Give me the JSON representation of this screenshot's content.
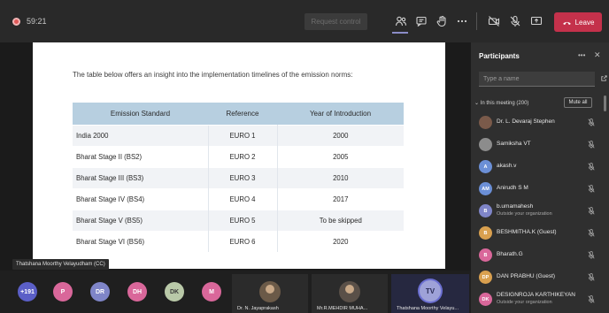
{
  "topbar": {
    "timer": "59:21",
    "request_control": "Request control",
    "leave": "Leave",
    "colors": {
      "leave": "#c4314b",
      "recording": "#e05a5a"
    }
  },
  "slide": {
    "intro": "The table below offers an insight into the implementation timelines of the emission norms:",
    "table": {
      "headers": [
        "Emission Standard",
        "Reference",
        "Year of Introduction"
      ],
      "rows": [
        [
          "India 2000",
          "EURO 1",
          "2000"
        ],
        [
          "Bharat Stage II (BS2)",
          "EURO 2",
          "2005"
        ],
        [
          "Bharat Stage III (BS3)",
          "EURO 3",
          "2010"
        ],
        [
          "Bharat Stage IV (BS4)",
          "EURO 4",
          "2017"
        ],
        [
          "Bharat Stage V (BS5)",
          "EURO 5",
          "To be skipped"
        ],
        [
          "Bharat Stage VI (BS6)",
          "EURO 6",
          "2020"
        ]
      ]
    }
  },
  "presenter_label": "Thatshana Moorthy Velayudham (CC)",
  "bottom": {
    "overflow_count": "+191",
    "avatars": [
      {
        "initials": "P",
        "color": "#d9679a"
      },
      {
        "initials": "DR",
        "color": "#7f85c8"
      },
      {
        "initials": "DH",
        "color": "#d9679a"
      },
      {
        "initials": "DK",
        "color": "#b9c9a8"
      },
      {
        "initials": "M",
        "color": "#d9679a"
      }
    ],
    "tiles": [
      {
        "name": "Dr. N. Jayaprakash"
      },
      {
        "name": "Mr.R.MEHDIR MUHA..."
      },
      {
        "name": "Thatshana Moorthy Velayu...",
        "initials": "TV"
      }
    ]
  },
  "participants": {
    "title": "Participants",
    "search_placeholder": "Type a name",
    "section": "In this meeting (200)",
    "mute_all": "Mute all",
    "list": [
      {
        "name": "Dr. L. Devaraj Stephen",
        "initials": "",
        "color": "#7a5a4a"
      },
      {
        "name": "Samiksha VT",
        "initials": "",
        "color": "#8c8c8c"
      },
      {
        "name": "akash.v",
        "initials": "A",
        "color": "#6b8fd6"
      },
      {
        "name": "Anirudh S M",
        "initials": "AM",
        "color": "#6b8fd6"
      },
      {
        "name": "b.umamahesh",
        "sub": "Outside your organization",
        "initials": "B",
        "color": "#7f85c8"
      },
      {
        "name": "BESHMITHA.K (Guest)",
        "initials": "B",
        "color": "#d9a04f"
      },
      {
        "name": "Bharath.G",
        "initials": "B",
        "color": "#d9679a"
      },
      {
        "name": "DAN PRABHU (Guest)",
        "initials": "DP",
        "color": "#d9a04f"
      },
      {
        "name": "DESIGNROJA KARTHIKEYAN",
        "sub": "Outside your organization",
        "initials": "DK",
        "color": "#d9679a"
      }
    ]
  }
}
